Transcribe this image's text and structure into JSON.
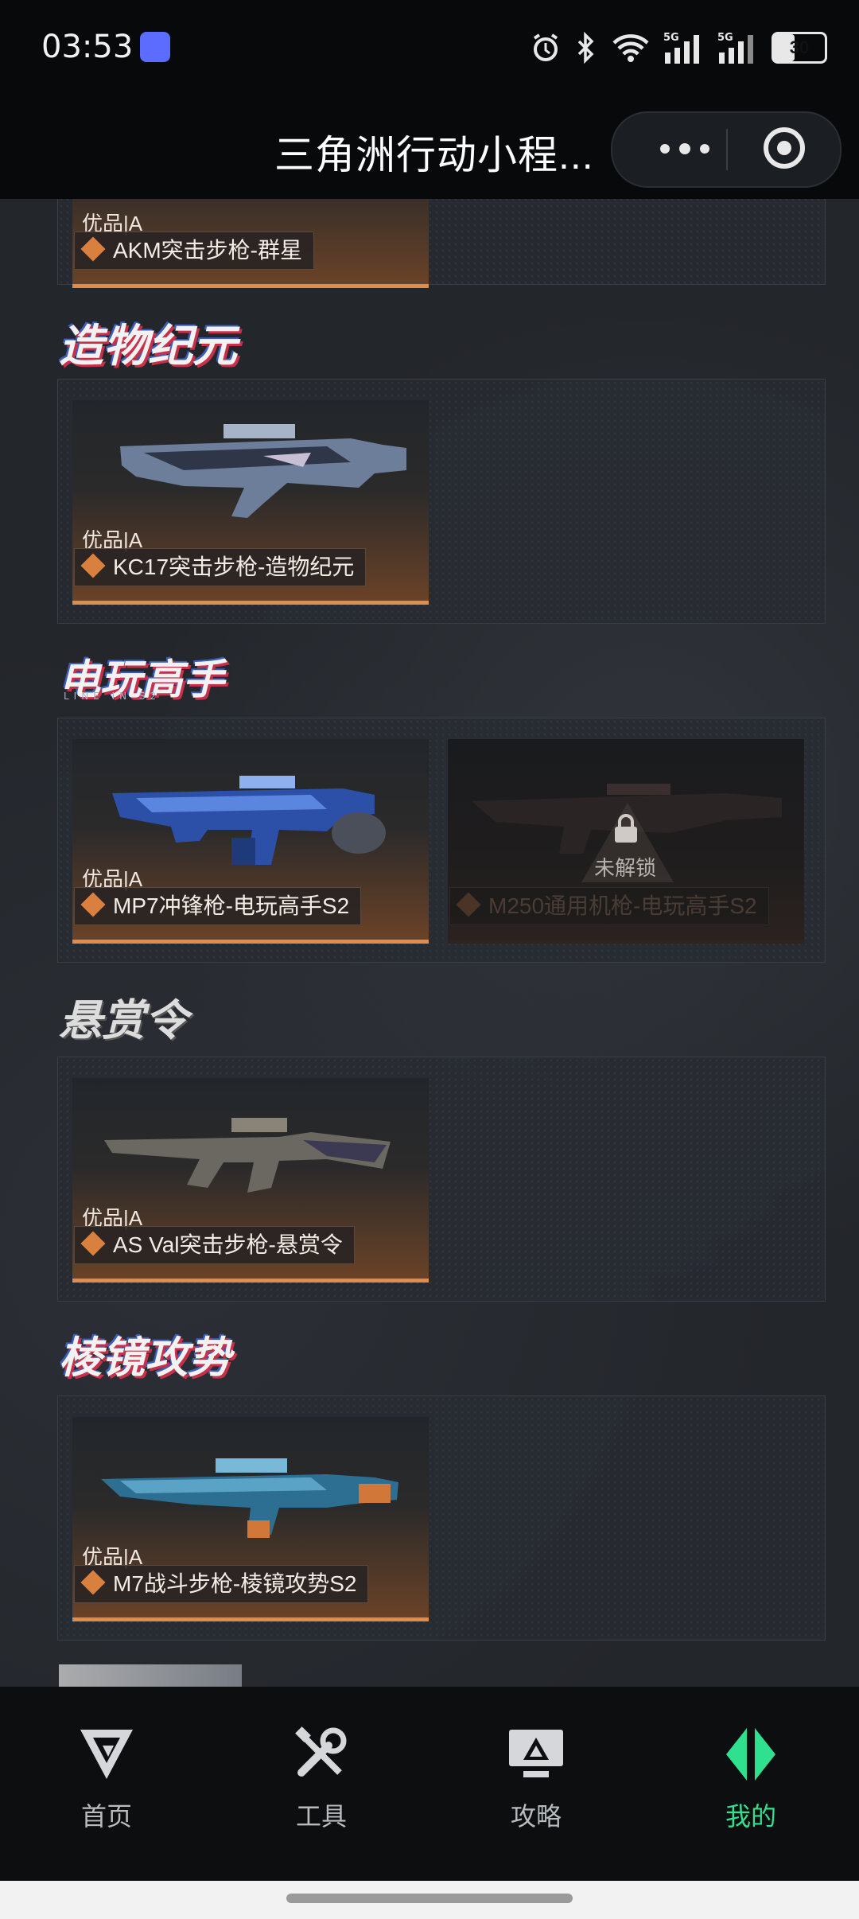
{
  "status_bar": {
    "time": "03:53",
    "signal_1": "5G",
    "signal_2": "5G",
    "battery": "30"
  },
  "title_bar": {
    "title": "三角洲行动小程..."
  },
  "sections": [
    {
      "banner": "",
      "items": [
        {
          "rarity": "优品|A",
          "name": "AKM突击步枪-群星",
          "locked": false
        }
      ]
    },
    {
      "banner": "造物纪元",
      "items": [
        {
          "rarity": "优品|A",
          "name": "KC17突击步枪-造物纪元",
          "locked": false
        }
      ]
    },
    {
      "banner": "电玩高手",
      "banner_sub": "LINE IN S2",
      "items": [
        {
          "rarity": "优品|A",
          "name": "MP7冲锋枪-电玩高手S2",
          "locked": false
        },
        {
          "rarity": "",
          "name": "M250通用机枪-电玩高手S2",
          "locked": true,
          "lock_text": "未解锁"
        }
      ]
    },
    {
      "banner": "悬赏令",
      "items": [
        {
          "rarity": "优品|A",
          "name": "AS Val突击步枪-悬赏令",
          "locked": false
        }
      ]
    },
    {
      "banner": "棱镜攻势",
      "items": [
        {
          "rarity": "优品|A",
          "name": "M7战斗步枪-棱镜攻势S2",
          "locked": false
        }
      ]
    }
  ],
  "tabs": [
    {
      "label": "首页",
      "icon": "home-g-logo-icon",
      "active": false
    },
    {
      "label": "工具",
      "icon": "tools-icon",
      "active": false
    },
    {
      "label": "攻略",
      "icon": "guide-monitor-icon",
      "active": false
    },
    {
      "label": "我的",
      "icon": "profile-logo-icon",
      "active": true
    }
  ],
  "colors": {
    "accent_orange": "#e08c4a",
    "active_tab": "#2fe08e",
    "background": "#23262b"
  }
}
